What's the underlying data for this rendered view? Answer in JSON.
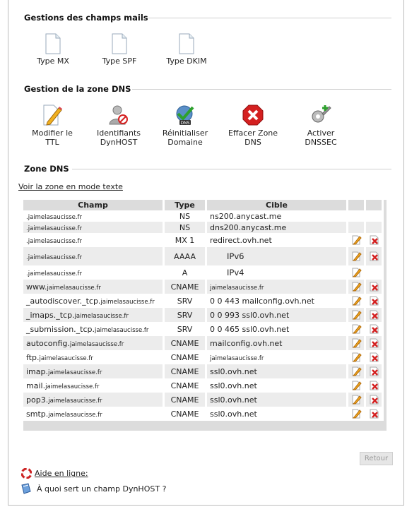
{
  "sections": {
    "mail_fields": "Gestions des champs mails",
    "dns_zone_mgmt": "Gestion de la zone DNS",
    "dns_zone": "Zone DNS"
  },
  "mail_tiles": [
    {
      "label": "Type MX",
      "icon": "document-icon"
    },
    {
      "label": "Type SPF",
      "icon": "document-icon"
    },
    {
      "label": "Type DKIM",
      "icon": "document-icon"
    }
  ],
  "dns_tiles": [
    {
      "line1": "Modifier le",
      "line2": "TTL",
      "icon": "pencil-document-icon"
    },
    {
      "line1": "Identifiants",
      "line2": "DynHOST",
      "icon": "user-block-icon"
    },
    {
      "line1": "Réinitialiser",
      "line2": "Domaine",
      "icon": "dns-globe-check-icon"
    },
    {
      "line1": "Effacer Zone",
      "line2": "DNS",
      "icon": "red-x-icon"
    },
    {
      "line1": "Activer",
      "line2": "DNSSEC",
      "icon": "key-plus-icon"
    }
  ],
  "view_text_link": "Voir la zone en mode texte",
  "table": {
    "headers": [
      "Champ",
      "Type",
      "Cible"
    ],
    "rows": [
      {
        "champ_prefix": "",
        "champ_domain": ".jaimelasaucisse.fr",
        "type": "NS",
        "cible": "ns200.anycast.me",
        "edit": false,
        "delete": false
      },
      {
        "champ_prefix": "",
        "champ_domain": ".jaimelasaucisse.fr",
        "type": "NS",
        "cible": "dns200.anycast.me",
        "edit": false,
        "delete": false
      },
      {
        "champ_prefix": "",
        "champ_domain": ".jaimelasaucisse.fr",
        "type": "MX 1",
        "cible": "redirect.ovh.net",
        "edit": true,
        "delete": true
      },
      {
        "champ_prefix": "",
        "champ_domain": ".jaimelasaucisse.fr",
        "type": "AAAA",
        "cible": "IPv6",
        "edit": true,
        "delete": true
      },
      {
        "champ_prefix": "",
        "champ_domain": ".jaimelasaucisse.fr",
        "type": "A",
        "cible": "IPv4",
        "edit": true,
        "delete": false
      },
      {
        "champ_prefix": "www.",
        "champ_domain": "jaimelasaucisse.fr",
        "type": "CNAME",
        "cible": "jaimelasaucisse.fr",
        "edit": true,
        "delete": true
      },
      {
        "champ_prefix": "_autodiscover._tcp.",
        "champ_domain": "jaimelasaucisse.fr",
        "type": "SRV",
        "cible": "0 0 443 mailconfig.ovh.net",
        "edit": true,
        "delete": true
      },
      {
        "champ_prefix": "_imaps._tcp.",
        "champ_domain": "jaimelasaucisse.fr",
        "type": "SRV",
        "cible": "0 0 993 ssl0.ovh.net",
        "edit": true,
        "delete": true
      },
      {
        "champ_prefix": "_submission._tcp.",
        "champ_domain": "jaimelasaucisse.fr",
        "type": "SRV",
        "cible": "0 0 465 ssl0.ovh.net",
        "edit": true,
        "delete": true
      },
      {
        "champ_prefix": "autoconfig.",
        "champ_domain": "jaimelasaucisse.fr",
        "type": "CNAME",
        "cible": "mailconfig.ovh.net",
        "edit": true,
        "delete": true
      },
      {
        "champ_prefix": "ftp.",
        "champ_domain": "jaimelasaucisse.fr",
        "type": "CNAME",
        "cible": "jaimelasaucisse.fr",
        "edit": true,
        "delete": true
      },
      {
        "champ_prefix": "imap.",
        "champ_domain": "jaimelasaucisse.fr",
        "type": "CNAME",
        "cible": "ssl0.ovh.net",
        "edit": true,
        "delete": true
      },
      {
        "champ_prefix": "mail.",
        "champ_domain": "jaimelasaucisse.fr",
        "type": "CNAME",
        "cible": "ssl0.ovh.net",
        "edit": true,
        "delete": true
      },
      {
        "champ_prefix": "pop3.",
        "champ_domain": "jaimelasaucisse.fr",
        "type": "CNAME",
        "cible": "ssl0.ovh.net",
        "edit": true,
        "delete": true
      },
      {
        "champ_prefix": "smtp.",
        "champ_domain": "jaimelasaucisse.fr",
        "type": "CNAME",
        "cible": "ssl0.ovh.net",
        "edit": true,
        "delete": true
      }
    ]
  },
  "retour_button": "Retour",
  "help_link": "Aide en ligne:",
  "dynhost_help": "À quoi sert un champ DynHOST ?",
  "colors": {
    "header_bg": "#dcdcdc",
    "odd_row": "#ececec",
    "delete_red": "#d42020",
    "edit_orange": "#e89a1c"
  }
}
